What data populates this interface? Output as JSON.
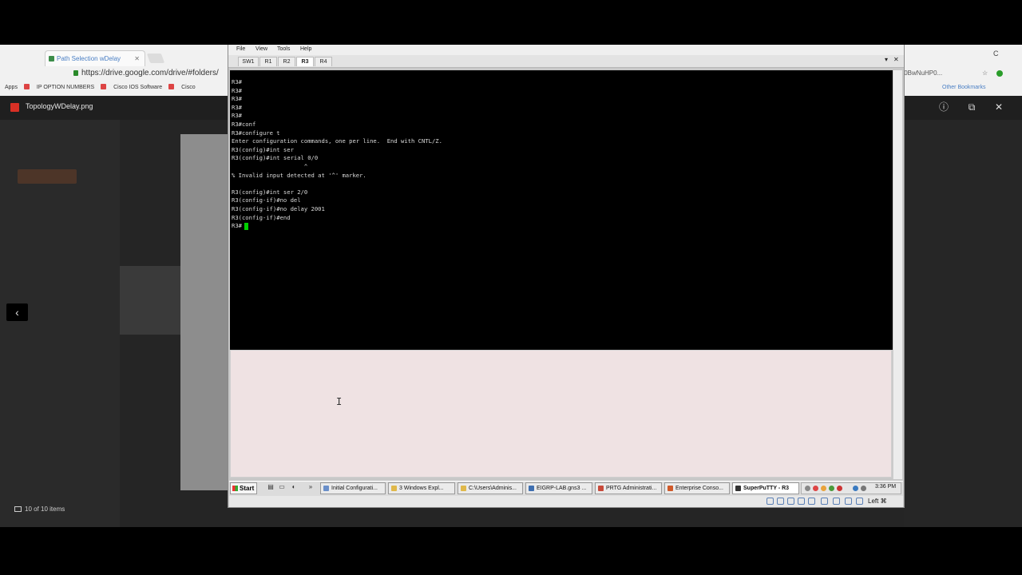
{
  "browser": {
    "tab_title": "Path Selection wDelay",
    "tab_close": "✕",
    "url": "https://drive.google.com/drive/#folders/",
    "url_right": "/0BwNuHP0...",
    "bookmarks": [
      "Apps",
      "IP OPTION NUMBERS",
      "Cisco IOS Software",
      "Cisco"
    ],
    "other_bookmarks": "Other Bookmarks",
    "profile_initial": "C"
  },
  "preview": {
    "file_name": "TopologyWDelay.png",
    "count_label": "10 of 10 items",
    "prev_arrow": "‹",
    "info_icon": "ⓘ",
    "open_icon": "⧉",
    "close_icon": "✕"
  },
  "putty": {
    "menu": [
      "File",
      "View",
      "Tools",
      "Help"
    ],
    "tabs": [
      "SW1",
      "R1",
      "R2",
      "R3",
      "R4"
    ],
    "active_tab": "R3",
    "dropdown": "▾",
    "close": "✕",
    "terminal_text": "R3#\nR3#\nR3#\nR3#\nR3#\nR3#conf\nR3#configure t\nEnter configuration commands, one per line.  End with CNTL/Z.\nR3(config)#int ser\nR3(config)#int serial 0/0\n                     ^\n% Invalid input detected at '^' marker.\n\nR3(config)#int ser 2/0\nR3(config-if)#no del\nR3(config-if)#no delay 2001\nR3(config-if)#end\nR3#"
  },
  "taskbar": {
    "start": "Start",
    "items": [
      {
        "label": "Initial Configurati..."
      },
      {
        "label": "3 Windows Expl..."
      },
      {
        "label": "C:\\Users\\Adminis..."
      },
      {
        "label": "EIGRP-LAB.gns3 ..."
      },
      {
        "label": "PRTG Administrati..."
      },
      {
        "label": "Enterprise Conso..."
      },
      {
        "label": "SuperPuTTY - R3"
      }
    ],
    "active_item": "SuperPuTTY - R3",
    "clock": "3:36 PM",
    "status_right": "Left ⌘"
  }
}
